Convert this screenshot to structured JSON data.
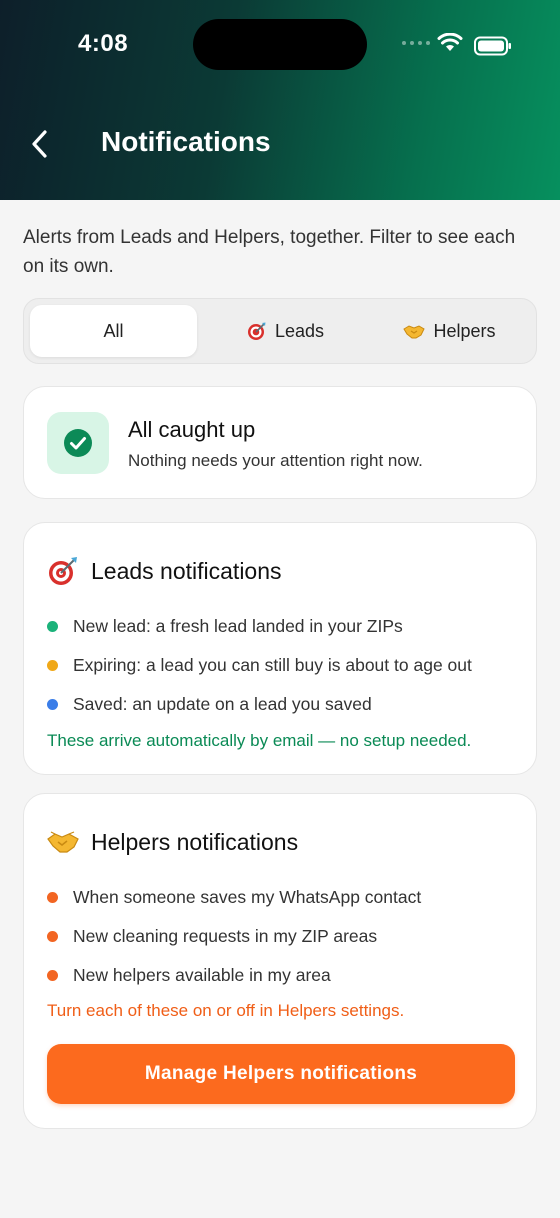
{
  "status_bar": {
    "time": "4:08"
  },
  "header": {
    "title": "Notifications"
  },
  "intro": "Alerts from Leads and Helpers, together. Filter to see each on its own.",
  "tabs": [
    {
      "label": "All",
      "active": true,
      "icon": ""
    },
    {
      "label": "Leads",
      "active": false,
      "icon": "target-icon"
    },
    {
      "label": "Helpers",
      "active": false,
      "icon": "handshake-icon"
    }
  ],
  "caught_up": {
    "title": "All caught up",
    "subtitle": "Nothing needs your attention right now.",
    "icon": "check-circle-icon"
  },
  "leads_card": {
    "title": "Leads notifications",
    "icon": "target-icon",
    "items": [
      {
        "text": "New lead: a fresh lead landed in your ZIPs",
        "color": "#1bb27a"
      },
      {
        "text": "Expiring: a lead you can still buy is about to age out",
        "color": "#f0a818"
      },
      {
        "text": "Saved: an update on a lead you saved",
        "color": "#3a7de8"
      }
    ],
    "note": "These arrive automatically by email — no setup needed."
  },
  "helpers_card": {
    "title": "Helpers notifications",
    "icon": "handshake-icon",
    "items": [
      {
        "text": "When someone saves my WhatsApp contact",
        "color": "#f26522"
      },
      {
        "text": "New cleaning requests in my ZIP areas",
        "color": "#f26522"
      },
      {
        "text": "New helpers available in my area",
        "color": "#f26522"
      }
    ],
    "note": "Turn each of these on or off in Helpers settings.",
    "button_label": "Manage Helpers notifications"
  },
  "colors": {
    "accent_green": "#0a8a55",
    "accent_orange": "#fc6a1e"
  }
}
